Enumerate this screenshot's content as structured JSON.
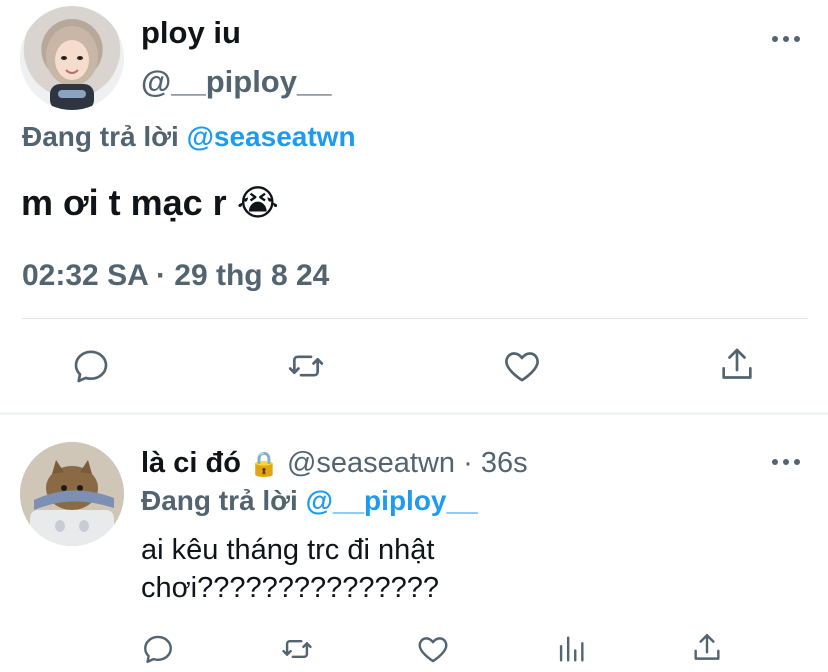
{
  "main_tweet": {
    "display_name": "ploy iu",
    "handle": "@__piploy__",
    "reply_prefix": "Đang trả lời",
    "reply_to": "@seaseatwn",
    "text": "m ơi t mạc r",
    "emoji": "😭",
    "timestamp": "02:32 SA · 29 thg 8 24"
  },
  "reply_tweet": {
    "display_name": "là ci đó",
    "lock_glyph": "🔒",
    "handle": "@seaseatwn",
    "separator": "·",
    "time": "36s",
    "reply_prefix": "Đang trả lời",
    "reply_to": "@__piploy__",
    "text_line1": "ai kêu tháng trc đi nhật",
    "text_line2": "chơi???????????????"
  },
  "icons": [
    "reply-icon",
    "retweet-icon",
    "like-icon",
    "share-icon",
    "analytics-icon",
    "more-icon",
    "lock-icon"
  ],
  "colors": {
    "accent": "#1d9bf0",
    "secondary_text": "#536471",
    "divider": "#eff3f4"
  }
}
